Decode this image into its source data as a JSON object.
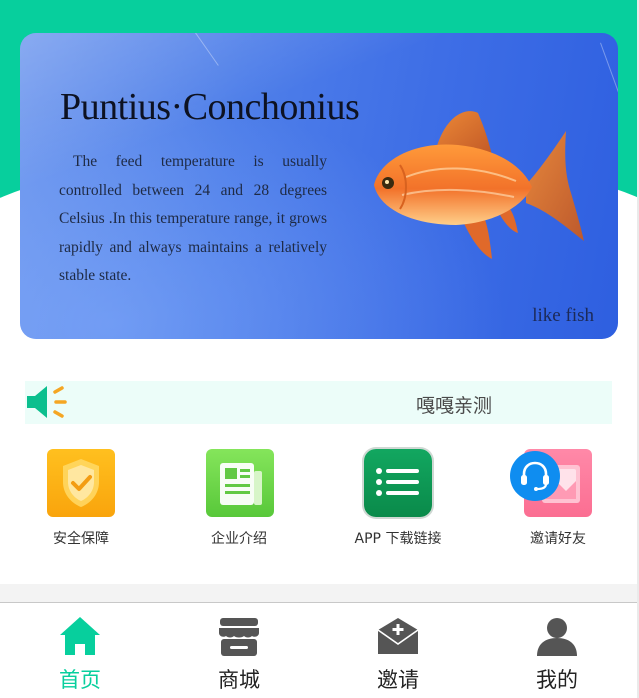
{
  "banner": {
    "title": "Puntius·Conchonius",
    "description": "The feed temperature is usually controlled between 24 and 28 degrees Celsius .In this temperature range, it grows rapidly and always maintains a relatively stable state.",
    "tag": "like fish"
  },
  "notice": {
    "icon": "speaker-icon",
    "text": "嘎嘎亲测"
  },
  "quick_menu": [
    {
      "label": "安全保障",
      "icon": "shield-check-icon",
      "color": "#fbb316"
    },
    {
      "label": "企业介绍",
      "icon": "newspaper-icon",
      "color": "#6cd64a"
    },
    {
      "label": "APP 下载链接",
      "icon": "list-icon",
      "color": "#0f9a55"
    },
    {
      "label": "邀请好友",
      "icon": "photo-card-icon",
      "color": "#fb7597"
    }
  ],
  "support": {
    "icon": "headset-icon",
    "color": "#0f8df0"
  },
  "tabbar": [
    {
      "label": "首页",
      "icon": "home-icon",
      "active": true
    },
    {
      "label": "商城",
      "icon": "store-icon",
      "active": false
    },
    {
      "label": "邀请",
      "icon": "invite-mail-icon",
      "active": false
    },
    {
      "label": "我的",
      "icon": "user-icon",
      "active": false
    }
  ],
  "colors": {
    "brand_green": "#07cf9d",
    "banner_blue": "#3e6ee6",
    "text_dark": "#222222"
  }
}
